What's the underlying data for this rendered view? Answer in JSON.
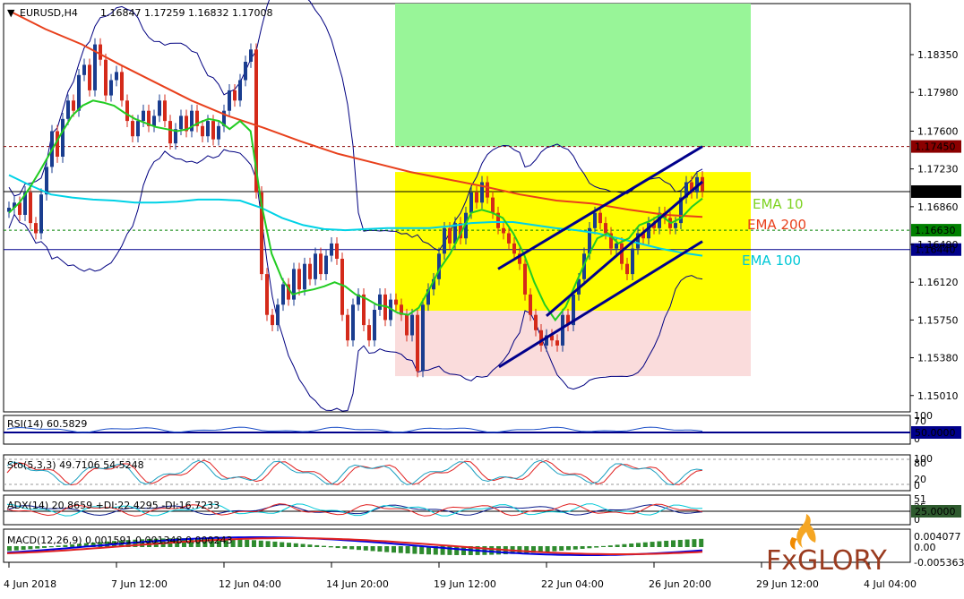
{
  "chart_data": {
    "type": "candlestick",
    "header": {
      "symbol": "EURUSD,H4",
      "ohlc": "1.16847 1.17259 1.16832 1.17008"
    },
    "price_axis": {
      "ylim": [
        1.1485,
        1.1885
      ],
      "ticks": [
        "1.18350",
        "1.17980",
        "1.17600",
        "1.17230",
        "1.16860",
        "1.16490",
        "1.16120",
        "1.15750",
        "1.15380",
        "1.15010"
      ],
      "tick_values": [
        1.1835,
        1.1798,
        1.176,
        1.1723,
        1.1686,
        1.1649,
        1.1612,
        1.1575,
        1.1538,
        1.1501
      ]
    },
    "x_ticks": [
      "4 Jun 2018",
      "7 Jun 12:00",
      "12 Jun 04:00",
      "14 Jun 20:00",
      "19 Jun 12:00",
      "22 Jun 04:00",
      "26 Jun 20:00",
      "29 Jun 12:00",
      "4 Jul 04:00"
    ],
    "x_tick_bars": [
      0,
      20,
      40,
      60,
      80,
      100,
      120,
      140,
      160
    ],
    "levels": [
      {
        "value": 1.1745,
        "label": "1.17450",
        "color": "#8b0000",
        "style": "dotted"
      },
      {
        "value": 1.17008,
        "label": "1.17008",
        "color": "#000000",
        "style": "solid"
      },
      {
        "value": 1.1663,
        "label": "1.16630",
        "color": "#008000",
        "style": "dotted"
      },
      {
        "value": 1.1644,
        "label": "1.16440",
        "color": "#00008b",
        "style": "solid"
      }
    ],
    "zones": [
      {
        "from": 1.1745,
        "to": 1.1885,
        "color": "#98f598"
      },
      {
        "from": 1.1584,
        "to": 1.172,
        "color": "#ffff00"
      },
      {
        "from": 1.152,
        "to": 1.1584,
        "color": "#fadcdc"
      }
    ],
    "ema_labels": [
      {
        "text": "EMA 10",
        "color": "#7ed321"
      },
      {
        "text": "EMA 200",
        "color": "#e8401c"
      },
      {
        "text": "EMA 100",
        "color": "#00c8d7"
      }
    ],
    "closes": [
      1.1685,
      1.169,
      1.1678,
      1.17,
      1.167,
      1.166,
      1.1698,
      1.1725,
      1.176,
      1.1735,
      1.1772,
      1.179,
      1.178,
      1.1815,
      1.1825,
      1.18,
      1.1845,
      1.183,
      1.1795,
      1.181,
      1.1818,
      1.179,
      1.177,
      1.1755,
      1.177,
      1.178,
      1.1765,
      1.1775,
      1.179,
      1.177,
      1.1748,
      1.1762,
      1.1775,
      1.176,
      1.178,
      1.1765,
      1.1755,
      1.177,
      1.1752,
      1.1765,
      1.178,
      1.18,
      1.179,
      1.181,
      1.1828,
      1.184,
      1.17,
      1.162,
      1.158,
      1.157,
      1.159,
      1.161,
      1.1595,
      1.1625,
      1.1605,
      1.163,
      1.1615,
      1.164,
      1.162,
      1.1638,
      1.165,
      1.1635,
      1.158,
      1.1555,
      1.159,
      1.16,
      1.157,
      1.1555,
      1.1585,
      1.16,
      1.1575,
      1.1595,
      1.159,
      1.158,
      1.156,
      1.158,
      1.1525,
      1.159,
      1.1605,
      1.1615,
      1.164,
      1.1665,
      1.165,
      1.167,
      1.1655,
      1.168,
      1.17,
      1.169,
      1.171,
      1.1695,
      1.168,
      1.1665,
      1.166,
      1.165,
      1.164,
      1.163,
      1.16,
      1.158,
      1.1565,
      1.155,
      1.156,
      1.1555,
      1.155,
      1.158,
      1.157,
      1.16,
      1.1615,
      1.164,
      1.1665,
      1.168,
      1.167,
      1.166,
      1.1645,
      1.165,
      1.163,
      1.162,
      1.1645,
      1.166,
      1.1655,
      1.167,
      1.1665,
      1.168,
      1.1675,
      1.1665,
      1.167,
      1.1695,
      1.171,
      1.17,
      1.1715,
      1.1701
    ],
    "ema10": [
      1.168,
      1.169,
      1.1705,
      1.1722,
      1.174,
      1.1758,
      1.1775,
      1.1785,
      1.179,
      1.1788,
      1.1785,
      1.1778,
      1.1772,
      1.1768,
      1.1764,
      1.1762,
      1.176,
      1.1762,
      1.1768,
      1.1772,
      1.177,
      1.1762,
      1.177,
      1.176,
      1.169,
      1.164,
      1.1615,
      1.16,
      1.1603,
      1.1605,
      1.1608,
      1.1612,
      1.1608,
      1.16,
      1.1596,
      1.159,
      1.1588,
      1.1582,
      1.158,
      1.1587,
      1.1605,
      1.1625,
      1.164,
      1.166,
      1.168,
      1.1683,
      1.168,
      1.1675,
      1.166,
      1.164,
      1.1612,
      1.159,
      1.1575,
      1.1588,
      1.1612,
      1.1635,
      1.1655,
      1.166,
      1.165,
      1.1655,
      1.1668,
      1.1672,
      1.1678,
      1.167,
      1.1675,
      1.1686,
      1.1694
    ],
    "ema100": [
      1.1717,
      1.1707,
      1.1698,
      1.1695,
      1.1693,
      1.1692,
      1.169,
      1.169,
      1.1691,
      1.1693,
      1.1693,
      1.1692,
      1.1685,
      1.1675,
      1.1668,
      1.1664,
      1.1663,
      1.1664,
      1.1665,
      1.1665,
      1.1665,
      1.1667,
      1.167,
      1.1671,
      1.1671,
      1.1668,
      1.1665,
      1.1663,
      1.166,
      1.1655,
      1.165,
      1.1645,
      1.1641,
      1.1638
    ],
    "ema200": [
      1.1878,
      1.186,
      1.1845,
      1.1826,
      1.1808,
      1.179,
      1.1775,
      1.1763,
      1.175,
      1.1738,
      1.1729,
      1.172,
      1.1713,
      1.1706,
      1.1698,
      1.1692,
      1.1689,
      1.1683,
      1.1678,
      1.1676
    ],
    "channel": {
      "upper": [
        [
          1.1625,
          1.1745
        ]
      ],
      "lower": [
        [
          1.1529,
          1.1652
        ]
      ]
    },
    "rsi": {
      "label": "RSI(14) 60.5829",
      "value": 60.5829,
      "ticks": [
        "100",
        "70",
        "30",
        "0"
      ],
      "level_label": "50.0000"
    },
    "stoch": {
      "label": "Sto(5,3,3) 49.7106 54.5248",
      "main": 49.7106,
      "signal": 54.5248,
      "ticks": [
        "100",
        "80",
        "20",
        "0"
      ]
    },
    "adx": {
      "label": "ADX(14) 20.8659 +DI:22.4295 -DI:16.7233",
      "adx": 20.8659,
      "plus_di": 22.4295,
      "minus_di": 16.7233,
      "ticks": [
        "51",
        "25",
        "0"
      ],
      "level_label": "25.0000"
    },
    "macd": {
      "label": "MACD(12,26,9) 0.001591 0.001348 0.000243",
      "ticks": [
        "0.004077",
        "0.00",
        "-0.005363"
      ]
    },
    "logo": {
      "text": "FxGLORY"
    }
  }
}
